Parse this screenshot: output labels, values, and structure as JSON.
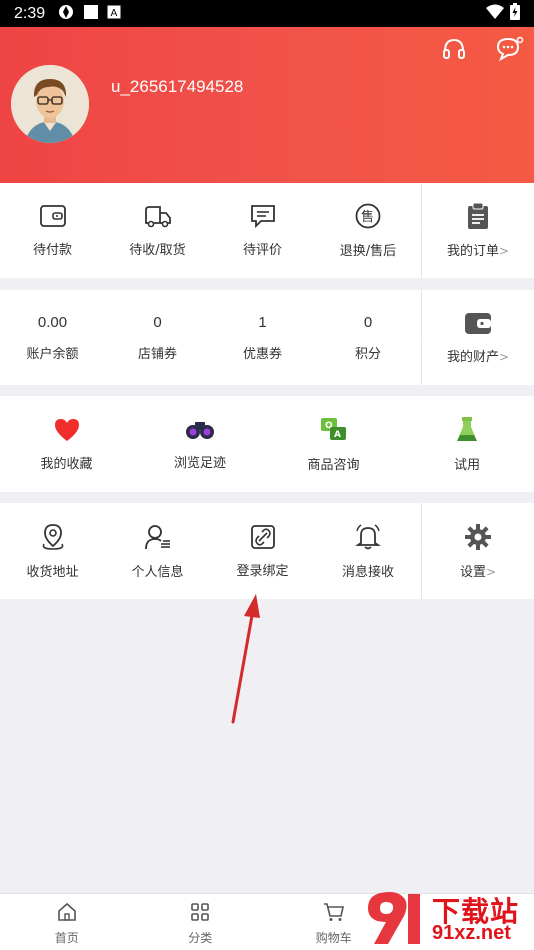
{
  "status_bar": {
    "time": "2:39"
  },
  "profile": {
    "username": "u_265617494528"
  },
  "orders": {
    "items": [
      {
        "label": "待付款",
        "icon": "wallet-icon"
      },
      {
        "label": "待收/取货",
        "icon": "truck-icon"
      },
      {
        "label": "待评价",
        "icon": "comment-icon"
      },
      {
        "label": "退换/售后",
        "icon": "aftersale-icon"
      }
    ],
    "side_label": "我的订单",
    "chevron": ">"
  },
  "assets": {
    "items": [
      {
        "value": "0.00",
        "label": "账户余额"
      },
      {
        "value": "0",
        "label": "店铺券"
      },
      {
        "value": "1",
        "label": "优惠券"
      },
      {
        "value": "0",
        "label": "积分"
      }
    ],
    "side_label": "我的财产",
    "chevron": ">"
  },
  "features": {
    "items": [
      {
        "label": "我的收藏",
        "icon": "heart-icon"
      },
      {
        "label": "浏览足迹",
        "icon": "binoculars-icon"
      },
      {
        "label": "商品咨询",
        "icon": "qa-icon"
      },
      {
        "label": "试用",
        "icon": "flask-icon"
      }
    ]
  },
  "tools": {
    "items": [
      {
        "label": "收货地址",
        "icon": "location-icon"
      },
      {
        "label": "个人信息",
        "icon": "person-icon"
      },
      {
        "label": "登录绑定",
        "icon": "link-icon"
      },
      {
        "label": "消息接收",
        "icon": "bell-icon"
      }
    ],
    "side_label": "设置",
    "chevron": ">"
  },
  "bottom_nav": [
    {
      "label": "首页",
      "icon": "home-icon"
    },
    {
      "label": "分类",
      "icon": "category-icon"
    },
    {
      "label": "购物车",
      "icon": "cart-icon"
    },
    {
      "label": "",
      "icon": ""
    }
  ],
  "watermark": {
    "text": "下载站",
    "sub": "91xz.net"
  },
  "colors": {
    "header_start": "#ef4444",
    "header_end": "#f55a43",
    "accent": "#e0141b"
  }
}
